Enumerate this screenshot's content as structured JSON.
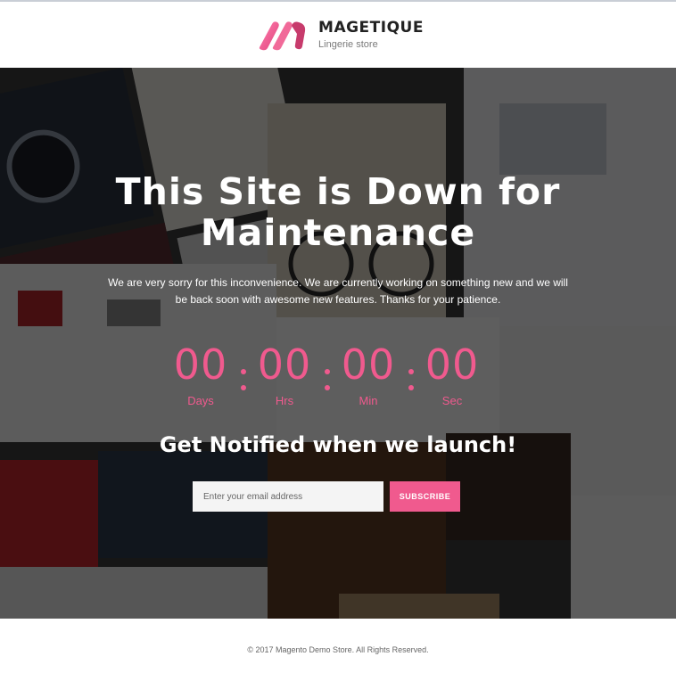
{
  "header": {
    "brand_name": "MAGETIQUE",
    "brand_tagline": "Lingerie store",
    "logo_icon": "magetique-logo-icon"
  },
  "hero": {
    "title_line1": "This Site is Down for",
    "title_line2": "Maintenance",
    "description_line1": "We are very sorry for this inconvenience. We are currently working on something new and we will",
    "description_line2": "be back soon with awesome new features. Thanks for your patience.",
    "background": "store-collage-image"
  },
  "countdown": {
    "units": [
      {
        "value": "00",
        "label": "Days"
      },
      {
        "value": "00",
        "label": "Hrs"
      },
      {
        "value": "00",
        "label": "Min"
      },
      {
        "value": "00",
        "label": "Sec"
      }
    ]
  },
  "notify": {
    "heading": "Get Notified when we launch!",
    "email_placeholder": "Enter your email address",
    "email_value": "",
    "subscribe_label": "SUBSCRIBE"
  },
  "footer": {
    "copyright": "© 2017 Magento Demo Store. All Rights Reserved."
  },
  "colors": {
    "accent": "#f05a8e",
    "text_dark": "#222222",
    "overlay": "#000000"
  }
}
